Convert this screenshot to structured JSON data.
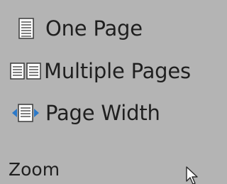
{
  "zoom_group": {
    "label": "Zoom",
    "commands": [
      {
        "label": "One Page",
        "icon": "one-page-icon"
      },
      {
        "label": "Multiple Pages",
        "icon": "multiple-pages-icon"
      },
      {
        "label": "Page Width",
        "icon": "page-width-icon"
      }
    ]
  },
  "colors": {
    "background": "#b4b4b4",
    "text": "#1f1f1f",
    "page_icon_fill": "#ffffff",
    "page_icon_stroke": "#3b3b3b",
    "arrow_accent": "#2b79c9"
  }
}
